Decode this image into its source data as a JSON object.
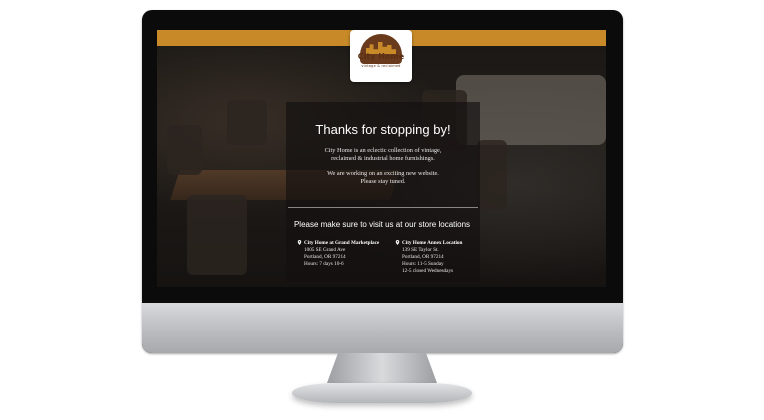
{
  "brand": {
    "name": "City Home",
    "tagline": "vintage & reclaimed"
  },
  "colors": {
    "accent": "#c88a28",
    "logo_brown": "#5a2f14"
  },
  "content": {
    "heading": "Thanks for stopping by!",
    "desc_line1": "City Home is an eclectic collection of vintage,",
    "desc_line2": "reclaimed & industrial home furnishings.",
    "notice_line1": "We are working on an exciting new website.",
    "notice_line2": "Please stay tuned.",
    "visit": "Please make sure to visit us at our store locations"
  },
  "locations": [
    {
      "icon": "location-pin-icon",
      "title": "City Home at Grand Marketplace",
      "address": "1005 SE Grand Ave",
      "city": "Portland, OR 97214",
      "hours": "Hours: 7 days 10-6",
      "extra": ""
    },
    {
      "icon": "location-pin-icon",
      "title": "City Home Annex Location",
      "address": "139 SE Taylor St.",
      "city": "Portland, OR 97214",
      "hours": "Hours: 11-5 Sunday",
      "extra": "12-5 closed Wednesdays"
    }
  ]
}
